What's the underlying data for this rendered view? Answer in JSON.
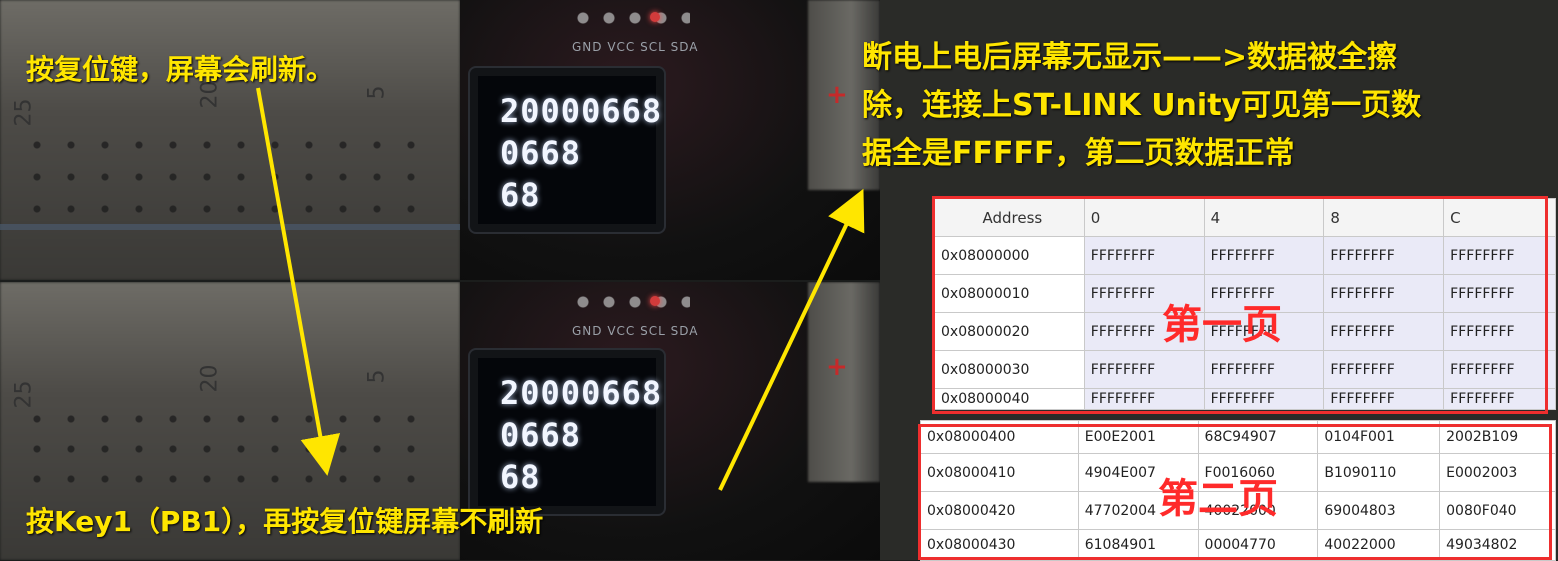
{
  "oled_top": {
    "pins": "GND VCC SCL SDA",
    "lines": [
      "20000668",
      "0668",
      "68"
    ]
  },
  "oled_bottom": {
    "pins": "GND VCC SCL SDA",
    "lines": [
      "20000668",
      "0668",
      "68"
    ]
  },
  "captions": {
    "top_left": "按复位键，屏幕会刷新。",
    "bottom_left": "按Key1（PB1），再按复位键屏幕不刷新",
    "right_line1": "断电上电后屏幕无显示——>数据被全擦",
    "right_line2": "除，连接上ST-LINK Unity可见第一页数",
    "right_line3": "据全是FFFFF，第二页数据正常"
  },
  "breadboard_marks": {
    "n20": "20",
    "n25": "25",
    "n5": "5"
  },
  "table_page1": {
    "headers": [
      "Address",
      "0",
      "4",
      "8",
      "C"
    ],
    "rows": [
      [
        "0x08000000",
        "FFFFFFFF",
        "FFFFFFFF",
        "FFFFFFFF",
        "FFFFFFFF"
      ],
      [
        "0x08000010",
        "FFFFFFFF",
        "FFFFFFFF",
        "FFFFFFFF",
        "FFFFFFFF"
      ],
      [
        "0x08000020",
        "FFFFFFFF",
        "FFFFFFFF",
        "FFFFFFFF",
        "FFFFFFFF"
      ],
      [
        "0x08000030",
        "FFFFFFFF",
        "FFFFFFFF",
        "FFFFFFFF",
        "FFFFFFFF"
      ],
      [
        "0x08000040",
        "FFFFFFFF",
        "FFFFFFFF",
        "FFFFFFFF",
        "FFFFFFFF"
      ]
    ],
    "label": "第一页"
  },
  "table_page2": {
    "rows": [
      [
        "0x08000400",
        "E00E2001",
        "68C94907",
        "0104F001",
        "2002B109"
      ],
      [
        "0x08000410",
        "4904E007",
        "F0016060",
        "B1090110",
        "E0002003"
      ],
      [
        "0x08000420",
        "47702004",
        "40022000",
        "69004803",
        "0080F040"
      ],
      [
        "0x08000430",
        "61084901",
        "00004770",
        "40022000",
        "49034802"
      ]
    ],
    "label": "第二页"
  },
  "colors": {
    "caption": "#ffe600",
    "highlight_box": "#ee2e2e",
    "page_label": "#ff2a2a"
  }
}
